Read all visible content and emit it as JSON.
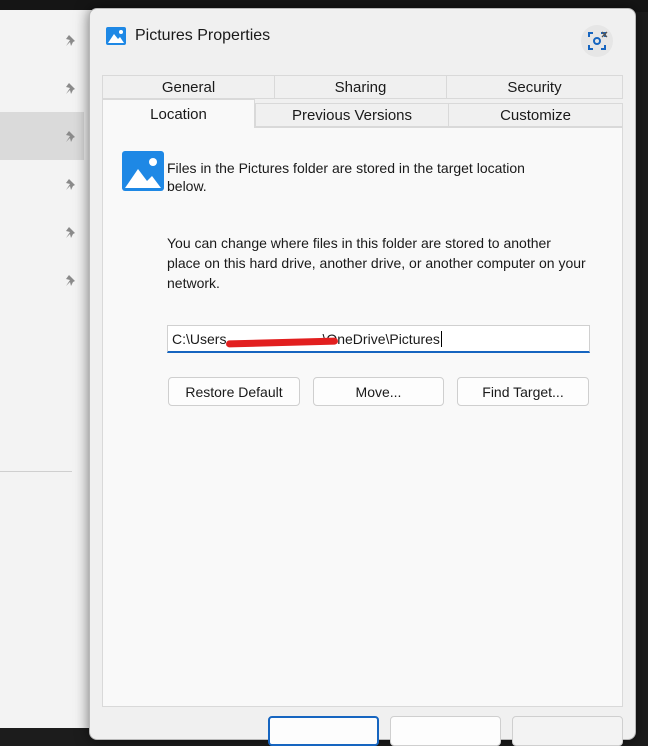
{
  "dialog": {
    "title": "Pictures Properties",
    "tabs_row1": [
      "General",
      "Sharing",
      "Security"
    ],
    "tabs_row2": [
      "Location",
      "Previous Versions",
      "Customize"
    ],
    "active_tab": "Location",
    "info_text": "Files in the Pictures folder are stored in the target location below.",
    "explain_text": "You can change where files in this folder are stored to another place on this hard drive, another drive, or another computer on your network.",
    "path": {
      "prefix": "C:\\Users",
      "suffix": "\\OneDrive\\Pictures"
    },
    "buttons": {
      "restore_default": "Restore Default",
      "move": "Move...",
      "find_target": "Find Target..."
    }
  },
  "colors": {
    "accent": "#1665c0",
    "redaction": "#e21f1f",
    "dialog_bg": "#f0f0f0"
  },
  "icons": {
    "title": "pictures-folder-icon",
    "close": "close-icon",
    "sidebar_pin": "pin-icon",
    "folder": "pictures-folder-icon"
  }
}
